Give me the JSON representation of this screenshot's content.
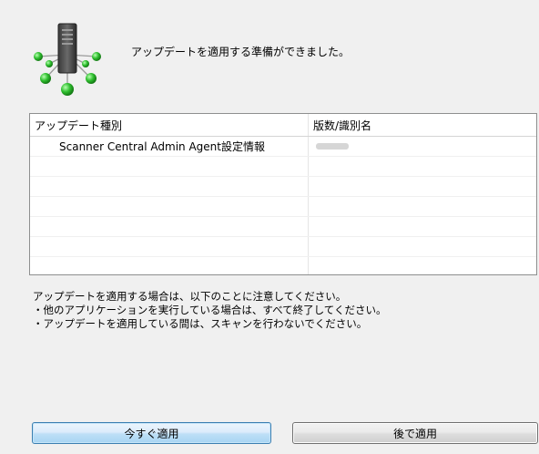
{
  "header": {
    "message": "アップデートを適用する準備ができました。",
    "icon": "server-network-icon"
  },
  "table": {
    "columns": [
      "アップデート種別",
      "版数/識別名"
    ],
    "rows": [
      {
        "type": "Scanner Central Admin Agent設定情報",
        "version": ""
      }
    ]
  },
  "notes": [
    "アップデートを適用する場合は、以下のことに注意してください。",
    "・他のアプリケーションを実行している場合は、すべて終了してください。",
    "・アップデートを適用している間は、スキャンを行わないでください。"
  ],
  "buttons": {
    "apply_now": "今すぐ適用",
    "apply_later": "後で適用"
  },
  "colors": {
    "background": "#f0f0f0",
    "primary_button_border": "#3c7fb1",
    "node_green": "#2fbf2f"
  }
}
